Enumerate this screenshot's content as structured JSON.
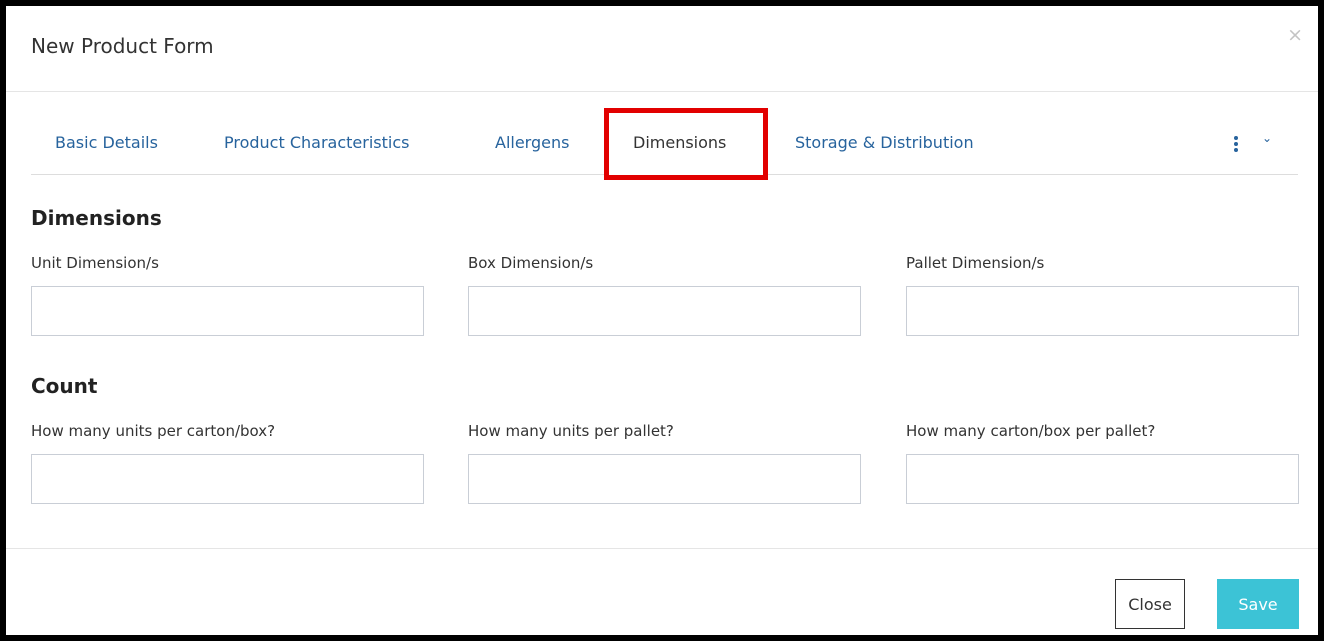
{
  "modal": {
    "title": "New Product Form",
    "close_glyph": "×"
  },
  "tabs": [
    {
      "label": "Basic Details",
      "active": false
    },
    {
      "label": "Product Characteristics",
      "active": false
    },
    {
      "label": "Allergens",
      "active": false
    },
    {
      "label": "Dimensions",
      "active": true
    },
    {
      "label": "Storage & Distribution",
      "active": false
    }
  ],
  "tab_overflow": {
    "icon": "kebab-menu-icon",
    "chevron": "⌄"
  },
  "dimensions": {
    "title": "Dimensions",
    "fields": [
      {
        "label": "Unit Dimension/s",
        "value": ""
      },
      {
        "label": "Box Dimension/s",
        "value": ""
      },
      {
        "label": "Pallet Dimension/s",
        "value": ""
      }
    ]
  },
  "count": {
    "title": "Count",
    "fields": [
      {
        "label": "How many units per carton/box?",
        "value": ""
      },
      {
        "label": "How many units per pallet?",
        "value": ""
      },
      {
        "label": "How many carton/box per pallet?",
        "value": ""
      }
    ]
  },
  "footer": {
    "close_label": "Close",
    "save_label": "Save"
  },
  "colors": {
    "link": "#27639d",
    "highlight": "#e20000",
    "save_button": "#3cc3d6"
  }
}
